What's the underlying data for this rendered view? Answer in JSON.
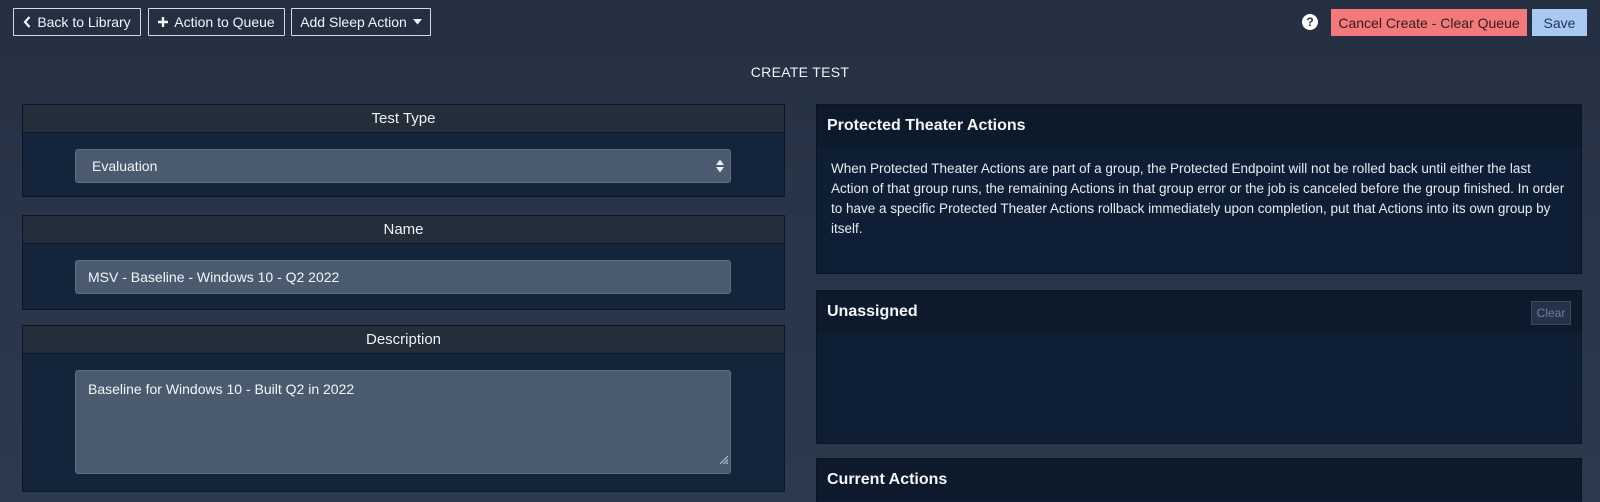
{
  "toolbar": {
    "back_label": "Back to Library",
    "queue_label": "Action to Queue",
    "sleep_label": "Add Sleep Action",
    "help_label": "?",
    "cancel_label": "Cancel Create - Clear Queue",
    "save_label": "Save"
  },
  "page": {
    "title": "CREATE TEST"
  },
  "form": {
    "test_type": {
      "label": "Test Type",
      "selected": "Evaluation"
    },
    "name": {
      "label": "Name",
      "value": "MSV - Baseline - Windows 10 - Q2 2022"
    },
    "description": {
      "label": "Description",
      "value": "Baseline for Windows 10 - Built Q2 in 2022"
    }
  },
  "side": {
    "pta": {
      "title": "Protected Theater Actions",
      "text": "When Protected Theater Actions are part of a group, the Protected Endpoint will not be rolled back until either the last Action of that group runs, the remaining Actions in that group error or the job is canceled before the group finished. In order to have a specific Protected Theater Actions rollback immediately upon completion, put that Actions into its own group by itself."
    },
    "unassigned": {
      "title": "Unassigned",
      "clear_label": "Clear"
    },
    "current": {
      "title": "Current Actions"
    }
  },
  "icons": {
    "back": "chevron-left-icon",
    "queue": "plus-icon",
    "sleep": "caret-down-icon",
    "help": "question-circle-icon",
    "select": "sort-arrows-icon",
    "resize": "resize-grip-icon"
  },
  "colors": {
    "background": "#283447",
    "panel_header": "#242d3a",
    "panel_body": "#13243b",
    "field": "#4a5b6f",
    "cancel": "#f27a7d",
    "save": "#a9c8f2"
  }
}
